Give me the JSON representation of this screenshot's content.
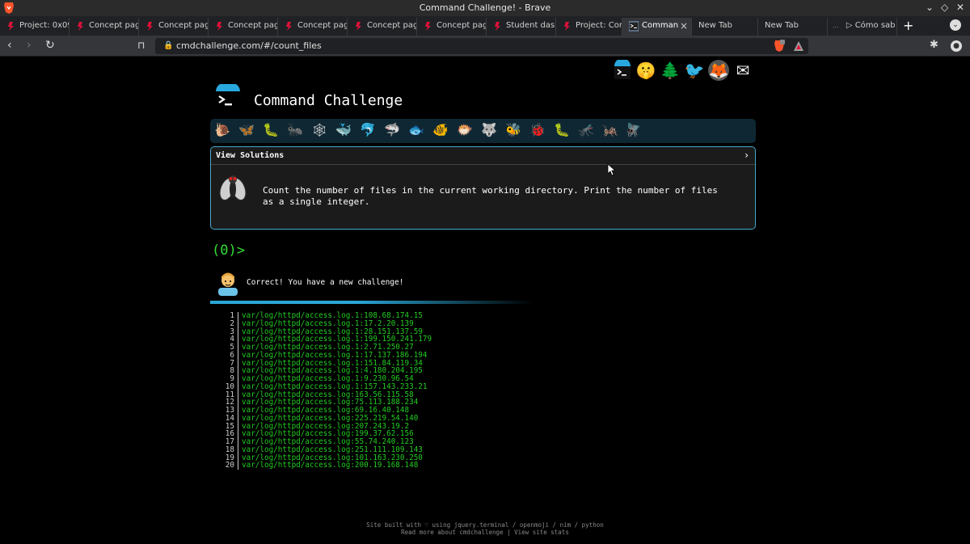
{
  "window": {
    "title": "Command Challenge! - Brave",
    "controls": [
      "⌄",
      "◇",
      "✕"
    ]
  },
  "tabs": [
    {
      "label": "Project: 0x09"
    },
    {
      "label": "Concept pag"
    },
    {
      "label": "Concept pag"
    },
    {
      "label": "Concept pag"
    },
    {
      "label": "Concept pag"
    },
    {
      "label": "Concept pag"
    },
    {
      "label": "Concept pag"
    },
    {
      "label": "Student dasl"
    },
    {
      "label": "Project: Com"
    },
    {
      "label": "Comman",
      "active": true,
      "close": "×"
    },
    {
      "label": "New Tab"
    },
    {
      "label": "New Tab"
    },
    {
      "label": "▷ Cómo sab",
      "prefix": "..."
    }
  ],
  "toolbar": {
    "url": "cmdchallenge.com/#/count_files",
    "back": "‹",
    "forward": "›",
    "reload": "↻",
    "new_tab": "+"
  },
  "social": [
    {
      "name": "cmdchallenge",
      "glyph": ""
    },
    {
      "name": "shushing-face",
      "glyph": "🤫"
    },
    {
      "name": "tree",
      "glyph": "🌲"
    },
    {
      "name": "twitter",
      "glyph": "🐦"
    },
    {
      "name": "gitlab",
      "glyph": "🦊"
    },
    {
      "name": "email",
      "glyph": "✉"
    }
  ],
  "app": {
    "title": "Command Challenge"
  },
  "challenge_icons": [
    "🐌",
    "🦋",
    "🐛",
    "🐜",
    "🕸",
    "🐳",
    "🐬",
    "🦈",
    "🐟",
    "🐠",
    "🐡",
    "🐺",
    "🐝",
    "🐞",
    "🐛",
    "🦟",
    "🦗",
    "🪰"
  ],
  "solutions": {
    "label": "View Solutions",
    "chevron": "›",
    "description": "Count the number of files in the current working directory. Print the number of files as a single integer."
  },
  "prompt": "(0)>",
  "result": {
    "message": "Correct! You have a new challenge!"
  },
  "output_lines": [
    {
      "n": "1",
      "text": "var/log/httpd/access.log.1:108.68.174.15"
    },
    {
      "n": "2",
      "text": "var/log/httpd/access.log.1:17.2.20.139"
    },
    {
      "n": "3",
      "text": "var/log/httpd/access.log.1:28.151.137.59"
    },
    {
      "n": "4",
      "text": "var/log/httpd/access.log.1:199.150.241.179"
    },
    {
      "n": "5",
      "text": "var/log/httpd/access.log.1:2.71.250.27"
    },
    {
      "n": "6",
      "text": "var/log/httpd/access.log.1:17.137.186.194"
    },
    {
      "n": "7",
      "text": "var/log/httpd/access.log.1:151.84.119.34"
    },
    {
      "n": "8",
      "text": "var/log/httpd/access.log.1:4.180.204.195"
    },
    {
      "n": "9",
      "text": "var/log/httpd/access.log.1:9.230.96.54"
    },
    {
      "n": "10",
      "text": "var/log/httpd/access.log.1:157.143.233.21"
    },
    {
      "n": "11",
      "text": "var/log/httpd/access.log:163.56.115.58"
    },
    {
      "n": "12",
      "text": "var/log/httpd/access.log:75.113.188.234"
    },
    {
      "n": "13",
      "text": "var/log/httpd/access.log:69.16.40.148"
    },
    {
      "n": "14",
      "text": "var/log/httpd/access.log:225.219.54.140"
    },
    {
      "n": "15",
      "text": "var/log/httpd/access.log:207.243.19.2"
    },
    {
      "n": "16",
      "text": "var/log/httpd/access.log:199.37.62.156"
    },
    {
      "n": "17",
      "text": "var/log/httpd/access.log:55.74.240.123"
    },
    {
      "n": "18",
      "text": "var/log/httpd/access.log:251.111.109.143"
    },
    {
      "n": "19",
      "text": "var/log/httpd/access.log:101.163.230.250"
    },
    {
      "n": "20",
      "text": "var/log/httpd/access.log:200.19.168.148"
    }
  ],
  "footer": {
    "line1": "Site built with ♡ using jquery.terminal / openmoji / nim / python",
    "line2": "Read more about cmdchallenge | View site stats"
  },
  "colors": {
    "accent": "#46a8c8",
    "prompt": "#33dd33",
    "output": "#22cc22",
    "background": "#000000"
  }
}
